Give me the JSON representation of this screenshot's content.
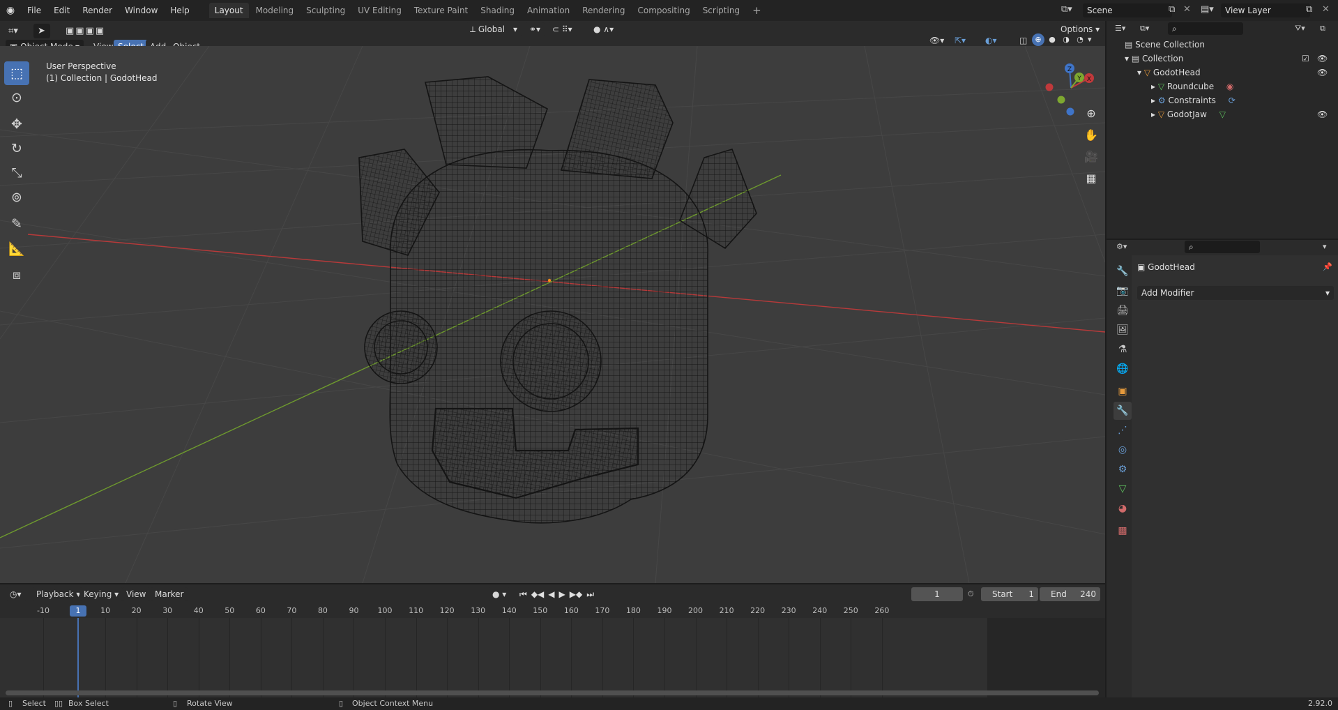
{
  "topbar": {
    "menus": [
      "File",
      "Edit",
      "Render",
      "Window",
      "Help"
    ],
    "workspaces": [
      "Layout",
      "Modeling",
      "Sculpting",
      "UV Editing",
      "Texture Paint",
      "Shading",
      "Animation",
      "Rendering",
      "Compositing",
      "Scripting"
    ],
    "active_workspace": "Layout",
    "add_workspace": "+",
    "scene_name": "Scene",
    "view_layer": "View Layer"
  },
  "viewport_header": {
    "mode": "Object Mode",
    "menus": [
      "View",
      "Select",
      "Add",
      "Object"
    ],
    "active_menu": "Select",
    "transform_orientation": "Global",
    "options_label": "Options"
  },
  "viewport": {
    "perspective_label": "User Perspective",
    "collection_label": "(1) Collection | GodotHead",
    "gizmo_axes": {
      "x": "X",
      "y": "Y",
      "z": "Z"
    },
    "colors": {
      "x_axis": "#b83a3a",
      "y_axis": "#6e9a2e",
      "background": "#3d3d3d"
    }
  },
  "toolbar": {
    "tools": [
      "select-box-icon",
      "cursor-icon",
      "move-icon",
      "rotate-icon",
      "scale-icon",
      "transform-icon",
      "annotate-icon",
      "measure-icon",
      "add-cube-icon"
    ]
  },
  "outliner": {
    "search_placeholder": "",
    "scene_collection": "Scene Collection",
    "collection": "Collection",
    "objects": [
      {
        "name": "GodotHead",
        "children": [
          "Roundcube",
          "Constraints",
          "GodotJaw"
        ]
      }
    ]
  },
  "properties": {
    "object_name": "GodotHead",
    "add_modifier": "Add Modifier"
  },
  "timeline": {
    "menus": [
      "Playback",
      "Keying",
      "View",
      "Marker"
    ],
    "current_frame": "1",
    "start_label": "Start",
    "start_value": "1",
    "end_label": "End",
    "end_value": "240",
    "ruler": [
      "-10",
      "1",
      "10",
      "20",
      "30",
      "40",
      "50",
      "60",
      "70",
      "80",
      "90",
      "100",
      "110",
      "120",
      "130",
      "140",
      "150",
      "160",
      "170",
      "180",
      "190",
      "200",
      "210",
      "220",
      "230",
      "240",
      "250",
      "260"
    ]
  },
  "statusbar": {
    "select": "Select",
    "box_select": "Box Select",
    "rotate_view": "Rotate View",
    "context_menu": "Object Context Menu",
    "version": "2.92.0"
  }
}
